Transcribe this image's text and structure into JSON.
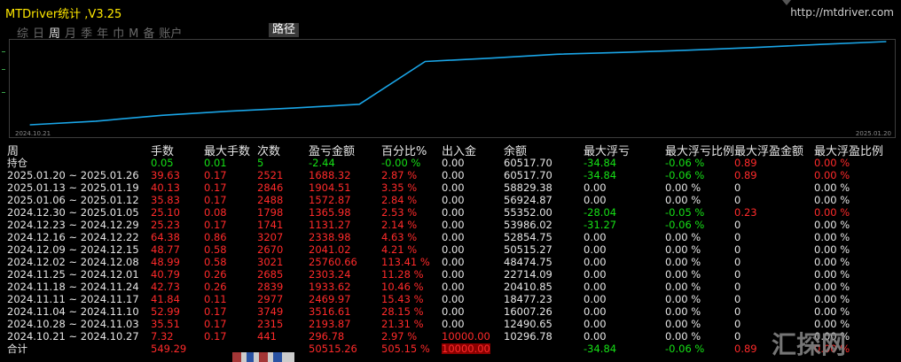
{
  "window": {
    "title": "MTDriver统计 ,V3.25",
    "url": "http://mtdriver.com"
  },
  "tabs": [
    {
      "label": "综",
      "active": false
    },
    {
      "label": "日",
      "active": false
    },
    {
      "label": "周",
      "active": true
    },
    {
      "label": "月",
      "active": false
    },
    {
      "label": "季",
      "active": false
    },
    {
      "label": "年",
      "active": false
    },
    {
      "label": "巾",
      "active": false
    },
    {
      "label": "M",
      "active": false
    },
    {
      "label": "备",
      "active": false
    },
    {
      "label": "账户",
      "active": false
    }
  ],
  "route_button": "路径",
  "chart_data": {
    "type": "line",
    "x_start_label": "2024.10.21",
    "x_end_label": "2025.01.20",
    "series_color": "#1aa6e8",
    "points": [
      {
        "x": "2024.10.21",
        "y": 10296.78
      },
      {
        "x": "2024.10.28",
        "y": 12490.65
      },
      {
        "x": "2024.11.04",
        "y": 16007.26
      },
      {
        "x": "2024.11.11",
        "y": 18477.23
      },
      {
        "x": "2024.11.18",
        "y": 20410.85
      },
      {
        "x": "2024.11.25",
        "y": 22714.09
      },
      {
        "x": "2024.12.02",
        "y": 48474.75
      },
      {
        "x": "2024.12.09",
        "y": 50515.27
      },
      {
        "x": "2024.12.16",
        "y": 52854.75
      },
      {
        "x": "2024.12.23",
        "y": 53986.02
      },
      {
        "x": "2024.12.30",
        "y": 55352.0
      },
      {
        "x": "2025.01.06",
        "y": 56924.87
      },
      {
        "x": "2025.01.13",
        "y": 58829.38
      },
      {
        "x": "2025.01.20",
        "y": 60517.7
      }
    ]
  },
  "table": {
    "headers": [
      "周",
      "手数",
      "最大手数",
      "次数",
      "盈亏金额",
      "百分比%",
      "出入金",
      "余额",
      "最大浮亏",
      "最大浮亏比例",
      "最大浮盈金额",
      "最大浮盈比例"
    ],
    "rows": [
      {
        "period": "持仓",
        "cells": [
          [
            "0.05",
            "g"
          ],
          [
            "0.01",
            "g"
          ],
          [
            "5",
            "g"
          ],
          [
            "-2.44",
            "g"
          ],
          [
            "-0.00 %",
            "g"
          ],
          [
            "0.00",
            "w"
          ],
          [
            "60517.70",
            "w"
          ],
          [
            "-34.84",
            "g"
          ],
          [
            "-0.06 %",
            "g"
          ],
          [
            "0.89",
            "r"
          ],
          [
            "0.00 %",
            "r"
          ]
        ]
      },
      {
        "period": "2025.01.20 ~ 2025.01.26",
        "cells": [
          [
            "39.63",
            "r"
          ],
          [
            "0.17",
            "r"
          ],
          [
            "2521",
            "r"
          ],
          [
            "1688.32",
            "r"
          ],
          [
            "2.87 %",
            "r"
          ],
          [
            "0.00",
            "w"
          ],
          [
            "60517.70",
            "w"
          ],
          [
            "-34.84",
            "g"
          ],
          [
            "-0.06 %",
            "g"
          ],
          [
            "0.89",
            "r"
          ],
          [
            "0.00 %",
            "r"
          ]
        ]
      },
      {
        "period": "2025.01.13 ~ 2025.01.19",
        "cells": [
          [
            "40.13",
            "r"
          ],
          [
            "0.17",
            "r"
          ],
          [
            "2846",
            "r"
          ],
          [
            "1904.51",
            "r"
          ],
          [
            "3.35 %",
            "r"
          ],
          [
            "0.00",
            "w"
          ],
          [
            "58829.38",
            "w"
          ],
          [
            "0.00",
            "w"
          ],
          [
            "0.00 %",
            "w"
          ],
          [
            "0",
            "w"
          ],
          [
            "0.00 %",
            "w"
          ]
        ]
      },
      {
        "period": "2025.01.06 ~ 2025.01.12",
        "cells": [
          [
            "35.83",
            "r"
          ],
          [
            "0.17",
            "r"
          ],
          [
            "2488",
            "r"
          ],
          [
            "1572.87",
            "r"
          ],
          [
            "2.84 %",
            "r"
          ],
          [
            "0.00",
            "w"
          ],
          [
            "56924.87",
            "w"
          ],
          [
            "0.00",
            "w"
          ],
          [
            "0.00 %",
            "w"
          ],
          [
            "0",
            "w"
          ],
          [
            "0.00 %",
            "w"
          ]
        ]
      },
      {
        "period": "2024.12.30 ~ 2025.01.05",
        "cells": [
          [
            "25.10",
            "r"
          ],
          [
            "0.08",
            "r"
          ],
          [
            "1798",
            "r"
          ],
          [
            "1365.98",
            "r"
          ],
          [
            "2.53 %",
            "r"
          ],
          [
            "0.00",
            "w"
          ],
          [
            "55352.00",
            "w"
          ],
          [
            "-28.04",
            "g"
          ],
          [
            "-0.05 %",
            "g"
          ],
          [
            "0.23",
            "r"
          ],
          [
            "0.00 %",
            "r"
          ]
        ]
      },
      {
        "period": "2024.12.23 ~ 2024.12.29",
        "cells": [
          [
            "25.23",
            "r"
          ],
          [
            "0.17",
            "r"
          ],
          [
            "1741",
            "r"
          ],
          [
            "1131.27",
            "r"
          ],
          [
            "2.14 %",
            "r"
          ],
          [
            "0.00",
            "w"
          ],
          [
            "53986.02",
            "w"
          ],
          [
            "-31.27",
            "g"
          ],
          [
            "-0.06 %",
            "g"
          ],
          [
            "0",
            "w"
          ],
          [
            "0.00 %",
            "w"
          ]
        ]
      },
      {
        "period": "2024.12.16 ~ 2024.12.22",
        "cells": [
          [
            "64.38",
            "r"
          ],
          [
            "0.86",
            "r"
          ],
          [
            "3207",
            "r"
          ],
          [
            "2338.98",
            "r"
          ],
          [
            "4.63 %",
            "r"
          ],
          [
            "0.00",
            "w"
          ],
          [
            "52854.75",
            "w"
          ],
          [
            "0.00",
            "w"
          ],
          [
            "0.00 %",
            "w"
          ],
          [
            "0",
            "w"
          ],
          [
            "0.00 %",
            "w"
          ]
        ]
      },
      {
        "period": "2024.12.09 ~ 2024.12.15",
        "cells": [
          [
            "48.77",
            "r"
          ],
          [
            "0.58",
            "r"
          ],
          [
            "2670",
            "r"
          ],
          [
            "2041.02",
            "r"
          ],
          [
            "4.21 %",
            "r"
          ],
          [
            "0.00",
            "w"
          ],
          [
            "50515.27",
            "w"
          ],
          [
            "0.00",
            "w"
          ],
          [
            "0.00 %",
            "w"
          ],
          [
            "0",
            "w"
          ],
          [
            "0.00 %",
            "w"
          ]
        ]
      },
      {
        "period": "2024.12.02 ~ 2024.12.08",
        "cells": [
          [
            "48.99",
            "r"
          ],
          [
            "0.58",
            "r"
          ],
          [
            "3021",
            "r"
          ],
          [
            "25760.66",
            "r"
          ],
          [
            "113.41 %",
            "r"
          ],
          [
            "0.00",
            "w"
          ],
          [
            "48474.75",
            "w"
          ],
          [
            "0.00",
            "w"
          ],
          [
            "0.00 %",
            "w"
          ],
          [
            "0",
            "w"
          ],
          [
            "0.00 %",
            "w"
          ]
        ]
      },
      {
        "period": "2024.11.25 ~ 2024.12.01",
        "cells": [
          [
            "40.79",
            "r"
          ],
          [
            "0.26",
            "r"
          ],
          [
            "2685",
            "r"
          ],
          [
            "2303.24",
            "r"
          ],
          [
            "11.28 %",
            "r"
          ],
          [
            "0.00",
            "w"
          ],
          [
            "22714.09",
            "w"
          ],
          [
            "0.00",
            "w"
          ],
          [
            "0.00 %",
            "w"
          ],
          [
            "0",
            "w"
          ],
          [
            "0.00 %",
            "w"
          ]
        ]
      },
      {
        "period": "2024.11.18 ~ 2024.11.24",
        "cells": [
          [
            "42.73",
            "r"
          ],
          [
            "0.26",
            "r"
          ],
          [
            "2839",
            "r"
          ],
          [
            "1933.62",
            "r"
          ],
          [
            "10.46 %",
            "r"
          ],
          [
            "0.00",
            "w"
          ],
          [
            "20410.85",
            "w"
          ],
          [
            "0.00",
            "w"
          ],
          [
            "0.00 %",
            "w"
          ],
          [
            "0",
            "w"
          ],
          [
            "0.00 %",
            "w"
          ]
        ]
      },
      {
        "period": "2024.11.11 ~ 2024.11.17",
        "cells": [
          [
            "41.84",
            "r"
          ],
          [
            "0.11",
            "r"
          ],
          [
            "2977",
            "r"
          ],
          [
            "2469.97",
            "r"
          ],
          [
            "15.43 %",
            "r"
          ],
          [
            "0.00",
            "w"
          ],
          [
            "18477.23",
            "w"
          ],
          [
            "0.00",
            "w"
          ],
          [
            "0.00 %",
            "w"
          ],
          [
            "0",
            "w"
          ],
          [
            "0.00 %",
            "w"
          ]
        ]
      },
      {
        "period": "2024.11.04 ~ 2024.11.10",
        "cells": [
          [
            "52.99",
            "r"
          ],
          [
            "0.17",
            "r"
          ],
          [
            "3749",
            "r"
          ],
          [
            "3516.61",
            "r"
          ],
          [
            "28.15 %",
            "r"
          ],
          [
            "0.00",
            "w"
          ],
          [
            "16007.26",
            "w"
          ],
          [
            "0.00",
            "w"
          ],
          [
            "0.00 %",
            "w"
          ],
          [
            "0",
            "w"
          ],
          [
            "0.00 %",
            "w"
          ]
        ]
      },
      {
        "period": "2024.10.28 ~ 2024.11.03",
        "cells": [
          [
            "35.51",
            "r"
          ],
          [
            "0.17",
            "r"
          ],
          [
            "2315",
            "r"
          ],
          [
            "2193.87",
            "r"
          ],
          [
            "21.31 %",
            "r"
          ],
          [
            "0.00",
            "w"
          ],
          [
            "12490.65",
            "w"
          ],
          [
            "0.00",
            "w"
          ],
          [
            "0.00 %",
            "w"
          ],
          [
            "0",
            "w"
          ],
          [
            "0.00 %",
            "w"
          ]
        ]
      },
      {
        "period": "2024.10.21 ~ 2024.10.27",
        "cells": [
          [
            "7.32",
            "r"
          ],
          [
            "0.17",
            "r"
          ],
          [
            "441",
            "r"
          ],
          [
            "296.78",
            "r"
          ],
          [
            "2.97 %",
            "r"
          ],
          [
            "10000.00",
            "r"
          ],
          [
            "10296.78",
            "w"
          ],
          [
            "0.00",
            "w"
          ],
          [
            "0.00 %",
            "w"
          ],
          [
            "0",
            "w"
          ],
          [
            "0.00 %",
            "w"
          ]
        ]
      },
      {
        "period": "合计",
        "cells": [
          [
            "549.29",
            "r"
          ],
          [
            "",
            "w"
          ],
          [
            "",
            "w"
          ],
          [
            "50515.26",
            "r"
          ],
          [
            "505.15 %",
            "r"
          ],
          [
            "10000.00",
            "r"
          ],
          [
            "",
            "w"
          ],
          [
            "-34.84",
            "g"
          ],
          [
            "-0.06 %",
            "g"
          ],
          [
            "0.89",
            "r"
          ],
          [
            "0.00 %",
            "r"
          ]
        ]
      }
    ]
  },
  "watermark": "汇探网"
}
